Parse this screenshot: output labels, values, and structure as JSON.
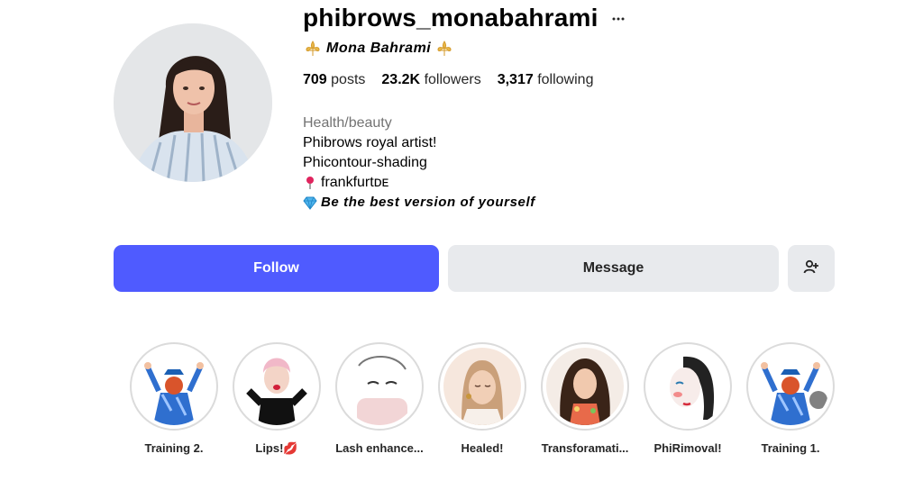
{
  "profile": {
    "username": "phibrows_monabahrami",
    "full_name": "Mona Bahrami",
    "stats": {
      "posts_count": "709",
      "posts_label": "posts",
      "followers_count": "23.2K",
      "followers_label": "followers",
      "following_count": "3,317",
      "following_label": "following"
    },
    "category": "Health/beauty",
    "bio_lines": {
      "line1": "Phibrows royal artist!",
      "line2": "Phicontour-shading",
      "line3": "frankfurtᴅᴇ",
      "line4": "Be the best version of yourself"
    }
  },
  "actions": {
    "follow_label": "Follow",
    "message_label": "Message",
    "add_user_icon": "person-add-icon"
  },
  "highlights": [
    {
      "label": "Training 2."
    },
    {
      "label": "Lips!💋"
    },
    {
      "label": "Lash enhance..."
    },
    {
      "label": "Healed!"
    },
    {
      "label": "Transforamati..."
    },
    {
      "label": "PhiRimoval!"
    },
    {
      "label": "Training 1."
    }
  ],
  "colors": {
    "follow_button": "#4f5bff",
    "secondary_button": "#e8eaed",
    "category_text": "#737373"
  }
}
